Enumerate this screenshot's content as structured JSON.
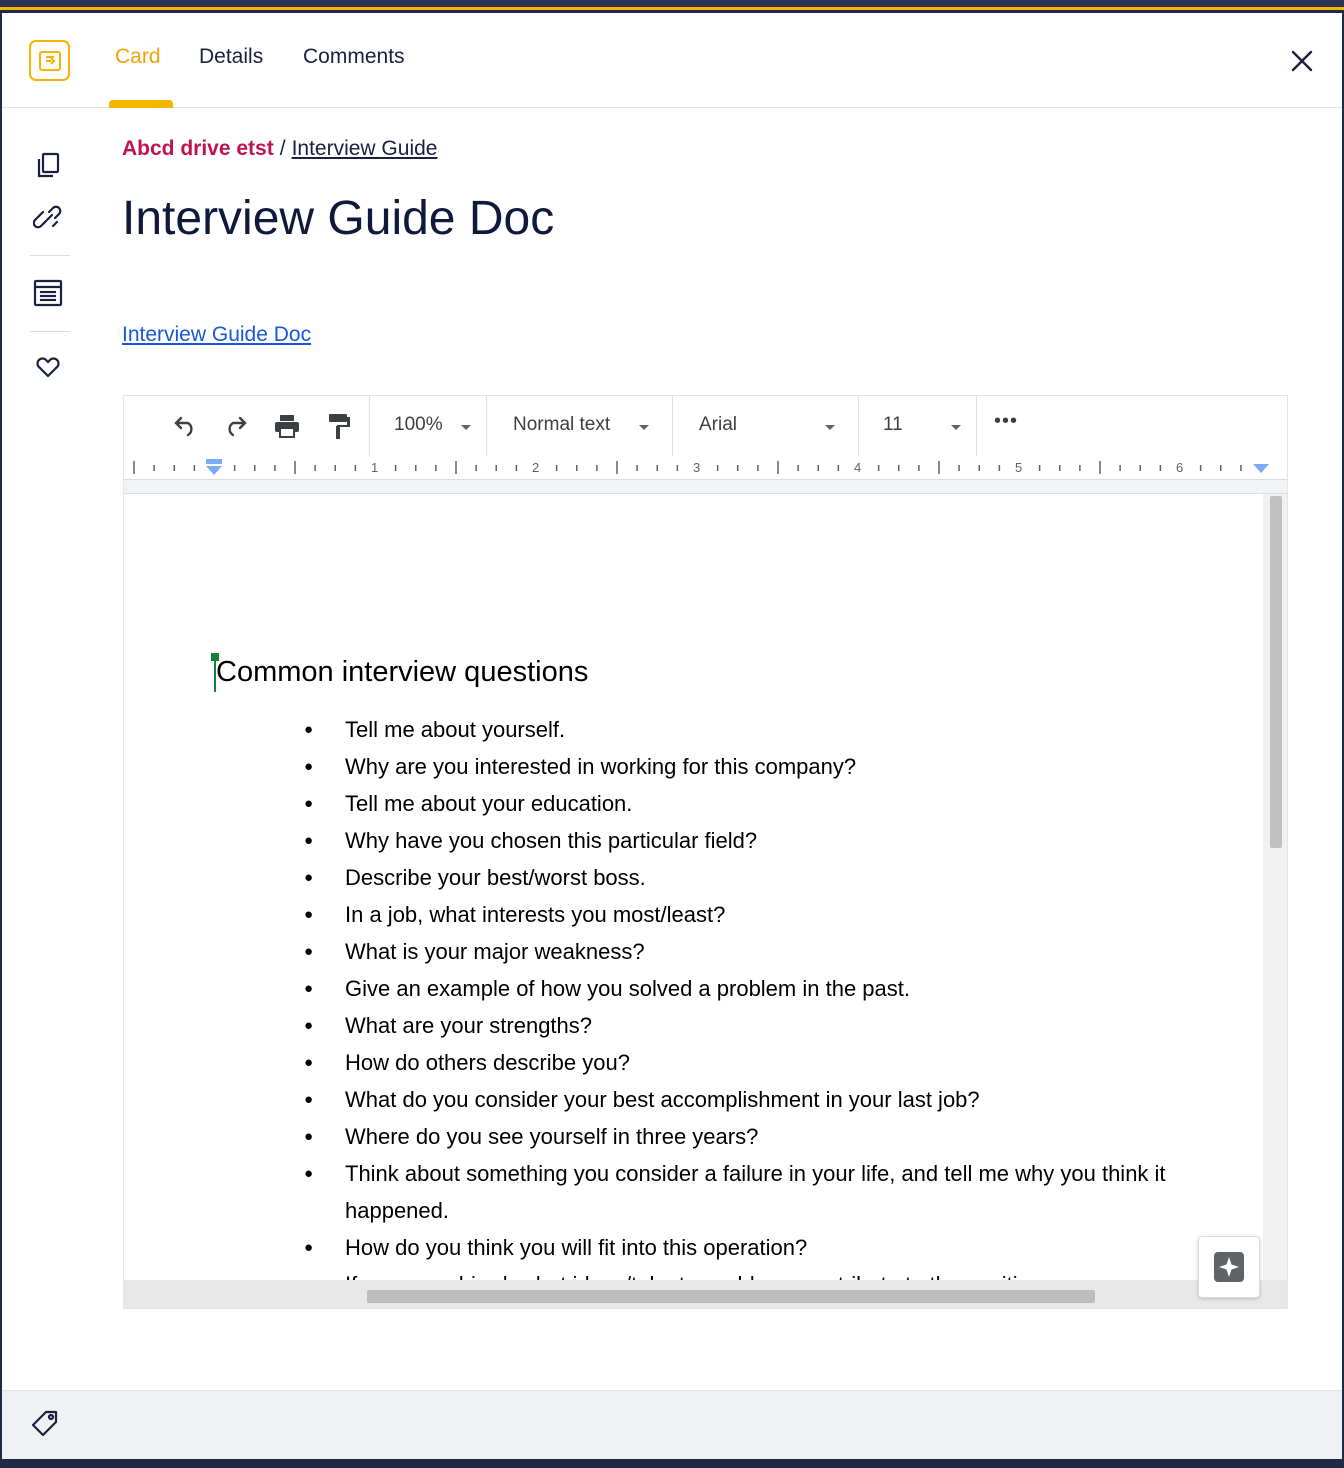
{
  "window": {
    "title": ""
  },
  "colors": {
    "accent": "#f4b400",
    "breadcrumb_root": "#c0134f",
    "link": "#1a56db",
    "title": "#0e1a3c"
  },
  "header": {
    "tabs": [
      {
        "label": "Card",
        "active": true
      },
      {
        "label": "Details",
        "active": false
      },
      {
        "label": "Comments",
        "active": false
      }
    ],
    "icons": {
      "app": "card-app-icon",
      "close": "close-icon"
    }
  },
  "sidebar": {
    "icons": [
      "copy-icon",
      "link-icon",
      "card-view-icon",
      "favorite-icon"
    ]
  },
  "breadcrumb": {
    "root": "Abcd drive etst",
    "separator": "/",
    "current": "Interview Guide"
  },
  "page": {
    "title": "Interview Guide Doc",
    "doc_link": "Interview Guide Doc"
  },
  "doc_toolbar": {
    "zoom": "100%",
    "style": "Normal text",
    "font": "Arial",
    "size": "11",
    "more": "•••",
    "icons": [
      "undo-icon",
      "redo-icon",
      "print-icon",
      "paint-format-icon"
    ]
  },
  "ruler": {
    "numbers": [
      "1",
      "2",
      "3",
      "4",
      "5",
      "6"
    ]
  },
  "document": {
    "heading": "Common interview questions",
    "questions": [
      "Tell me about yourself.",
      "Why are you interested in working for this company?",
      "Tell me about your education.",
      "Why have you chosen this particular field?",
      "Describe your best/worst boss.",
      "In a job, what interests you most/least?",
      "What is your major weakness?",
      "Give an example of how you solved a problem in the past.",
      "What are your strengths?",
      "How do others describe you?",
      "What do you consider your best accomplishment in your last job?",
      "Where do you see yourself in three years?",
      "Think about something you consider a failure in your life, and tell me why you think it happened.",
      "How do you think you will fit into this operation?",
      "If you were hired, what ideas/talents could you contribute to the position or our"
    ]
  },
  "footer": {
    "icons": [
      "tag-icon"
    ]
  }
}
